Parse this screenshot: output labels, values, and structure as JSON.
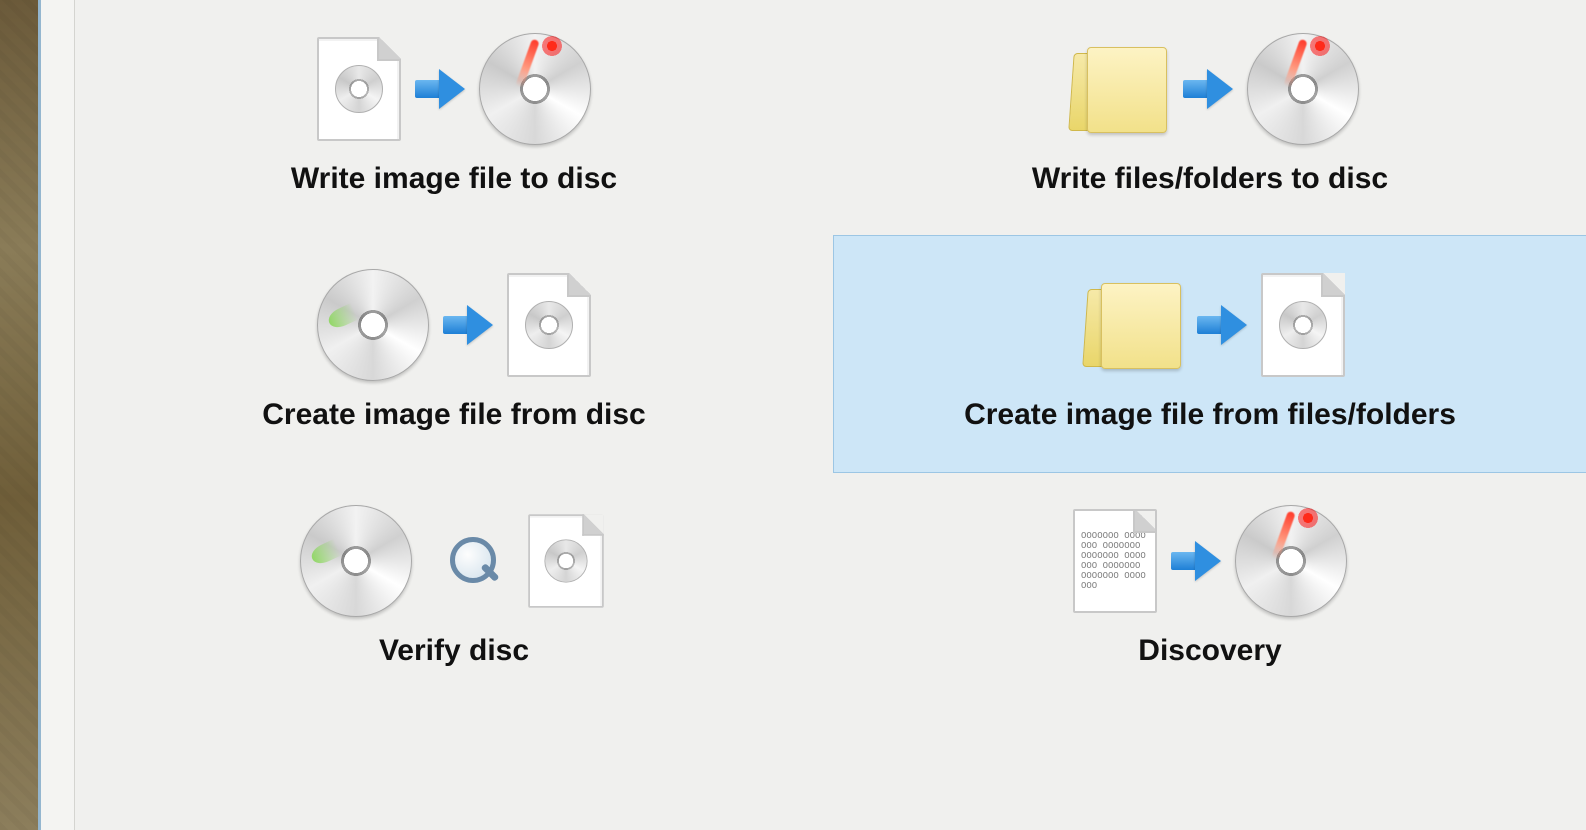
{
  "actions": [
    {
      "id": "write-image-to-disc",
      "label": "Write image file to disc",
      "selected": false
    },
    {
      "id": "write-files-to-disc",
      "label": "Write files/folders to disc",
      "selected": false
    },
    {
      "id": "create-image-from-disc",
      "label": "Create image file from disc",
      "selected": false
    },
    {
      "id": "create-image-from-files",
      "label": "Create image file from files/folders",
      "selected": true
    },
    {
      "id": "verify-disc",
      "label": "Verify disc",
      "selected": false
    },
    {
      "id": "discovery",
      "label": "Discovery",
      "selected": false
    }
  ],
  "binary_filler": "OOOOOOO OOOOOOO OOOOOOO OOOOOOO OOOOOOO OOOOOOO OOOOOOO OOOOOOO"
}
